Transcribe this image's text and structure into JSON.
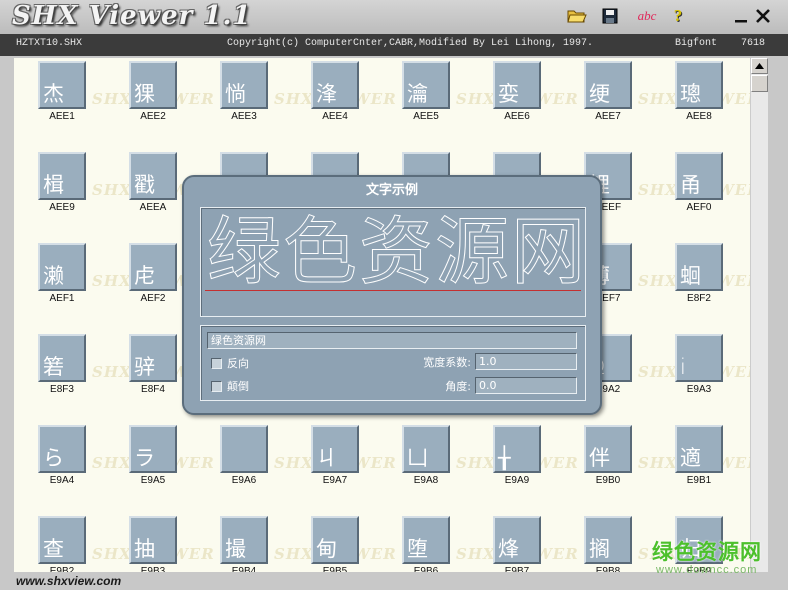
{
  "titlebar": {
    "title": "SHX Viewer 1.1",
    "icons": [
      "open-folder-icon",
      "save-disk-icon",
      "text-sample-icon",
      "help-icon",
      "minimize-icon",
      "close-icon"
    ],
    "text_button_label": "abc",
    "help_label": "?"
  },
  "infobar": {
    "file": "HZTXT10.SHX",
    "copyright": "Copyright(c) ComputerCnter,CABR,Modified By Lei Lihong,  1997.",
    "font_type": "Bigfont",
    "count": "7618"
  },
  "watermark_text": "SHX VIEWER",
  "grid": {
    "cells": [
      {
        "glyph": "杰",
        "code": "AEE1"
      },
      {
        "glyph": "猓",
        "code": "AEE2"
      },
      {
        "glyph": "惝",
        "code": "AEE3"
      },
      {
        "glyph": "浲",
        "code": "AEE4"
      },
      {
        "glyph": "瀹",
        "code": "AEE5"
      },
      {
        "glyph": "娈",
        "code": "AEE6"
      },
      {
        "glyph": "绠",
        "code": "AEE7"
      },
      {
        "glyph": "璁",
        "code": "AEE8"
      },
      {
        "glyph": "楫",
        "code": "AEE9"
      },
      {
        "glyph": "戳",
        "code": "AEEA"
      },
      {
        "glyph": "",
        "code": ""
      },
      {
        "glyph": "",
        "code": ""
      },
      {
        "glyph": "",
        "code": ""
      },
      {
        "glyph": "",
        "code": ""
      },
      {
        "glyph": "锂",
        "code": "AEEF"
      },
      {
        "glyph": "甬",
        "code": "AEF0"
      },
      {
        "glyph": "濑",
        "code": "AEF1"
      },
      {
        "glyph": "虍",
        "code": "AEF2"
      },
      {
        "glyph": "",
        "code": ""
      },
      {
        "glyph": "",
        "code": ""
      },
      {
        "glyph": "",
        "code": ""
      },
      {
        "glyph": "",
        "code": ""
      },
      {
        "glyph": "薄",
        "code": "AEF7"
      },
      {
        "glyph": "蛔",
        "code": "E8F2"
      },
      {
        "glyph": "箬",
        "code": "E8F3"
      },
      {
        "glyph": "骍",
        "code": "E8F4"
      },
      {
        "glyph": "",
        "code": ""
      },
      {
        "glyph": "",
        "code": ""
      },
      {
        "glyph": "",
        "code": ""
      },
      {
        "glyph": "",
        "code": ""
      },
      {
        "glyph": "Ω",
        "code": "E9A2"
      },
      {
        "glyph": "ⅰ",
        "code": "E9A3"
      },
      {
        "glyph": "ら",
        "code": "E9A4"
      },
      {
        "glyph": "ラ",
        "code": "E9A5"
      },
      {
        "glyph": "",
        "code": "E9A6"
      },
      {
        "glyph": "ㄐ",
        "code": "E9A7"
      },
      {
        "glyph": "凵",
        "code": "E9A8"
      },
      {
        "glyph": "╁",
        "code": "E9A9"
      },
      {
        "glyph": "伴",
        "code": "E9B0"
      },
      {
        "glyph": "適",
        "code": "E9B1"
      },
      {
        "glyph": "查",
        "code": "E9B2"
      },
      {
        "glyph": "抽",
        "code": "E9B3"
      },
      {
        "glyph": "撮",
        "code": "E9B4"
      },
      {
        "glyph": "甸",
        "code": "E9B5"
      },
      {
        "glyph": "堕",
        "code": "E9B6"
      },
      {
        "glyph": "烽",
        "code": "E9B7"
      },
      {
        "glyph": "搁",
        "code": "E9B8"
      },
      {
        "glyph": "归",
        "code": "E9B9"
      }
    ]
  },
  "dialog": {
    "title": "文字示例",
    "preview_text": "绿色资源网",
    "text_input_value": "绿色资源网",
    "reverse_label": "反向",
    "invert_label": "颠倒",
    "width_label": "宽度系数:",
    "width_value": "1.0",
    "angle_label": "角度:",
    "angle_value": "0.0"
  },
  "footer": {
    "url": "www.shxview.com"
  },
  "corner_brand": {
    "name": "绿色资源网",
    "url": "www.downcc.com"
  }
}
